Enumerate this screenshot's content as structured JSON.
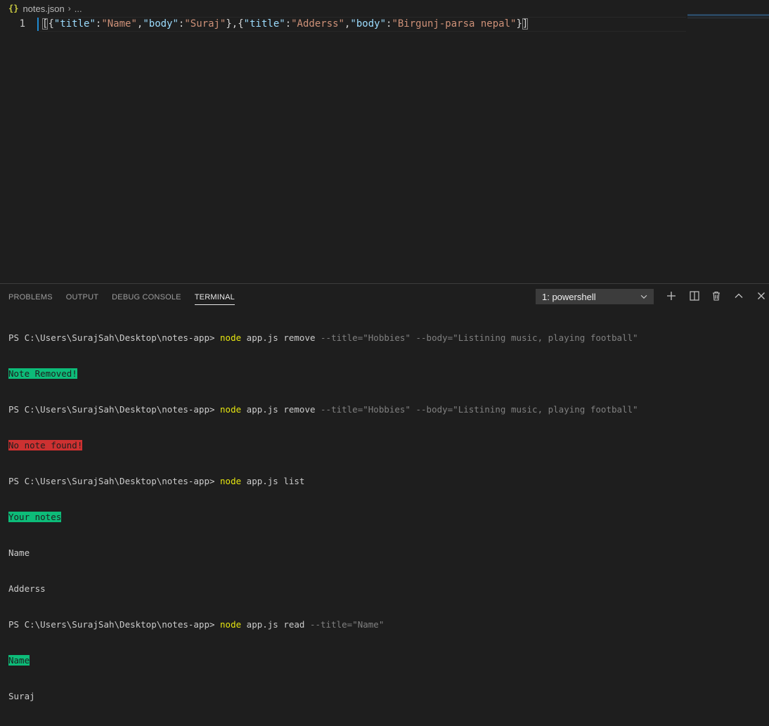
{
  "breadcrumb": {
    "icon": "{}",
    "file": "notes.json",
    "separator": "›",
    "more": "..."
  },
  "editor": {
    "line_number": "1",
    "code": {
      "t1": "[",
      "t2": "{",
      "k1": "\"title\"",
      "c1": ":",
      "v1": "\"Name\"",
      "m1": ",",
      "k2": "\"body\"",
      "c2": ":",
      "v2": "\"Suraj\"",
      "m2": "},{",
      "k3": "\"title\"",
      "c3": ":",
      "v3": "\"Adderss\"",
      "m3": ",",
      "k4": "\"body\"",
      "c4": ":",
      "v4": "\"Birgunj-parsa nepal\"",
      "m4": "}",
      "t3": "]"
    }
  },
  "panel": {
    "tabs": [
      "PROBLEMS",
      "OUTPUT",
      "DEBUG CONSOLE",
      "TERMINAL"
    ],
    "active_tab": "TERMINAL",
    "shell_value": "1: powershell",
    "buttons": [
      "new-terminal",
      "split-terminal",
      "kill-terminal",
      "maximize-panel",
      "close-panel"
    ]
  },
  "terminal": {
    "prompt": "PS C:\\Users\\SurajSah\\Desktop\\notes-app> ",
    "cmd_node": "node",
    "l1_args": " app.js remove ",
    "l1_flags": "--title=\"Hobbies\" --body=\"Listining music, playing football\"",
    "l2_out": "Note Removed!",
    "l3_args": " app.js remove ",
    "l3_flags": "--title=\"Hobbies\" --body=\"Listining music, playing football\"",
    "l4_out": "No note found!",
    "l5_args": " app.js list",
    "l6_out": "Your notes",
    "l7_out": "Name",
    "l8_out": "Adderss",
    "l9_args": " app.js read ",
    "l9_flags": "--title=\"Name\"",
    "l10_out": "Name",
    "l11_out": "Suraj"
  },
  "colors": {
    "background": "#1e1e1e",
    "accent_blue": "#1f8ad2",
    "success_green": "#0dbc79",
    "error_red": "#cd3131",
    "command_yellow": "#e5e510"
  }
}
